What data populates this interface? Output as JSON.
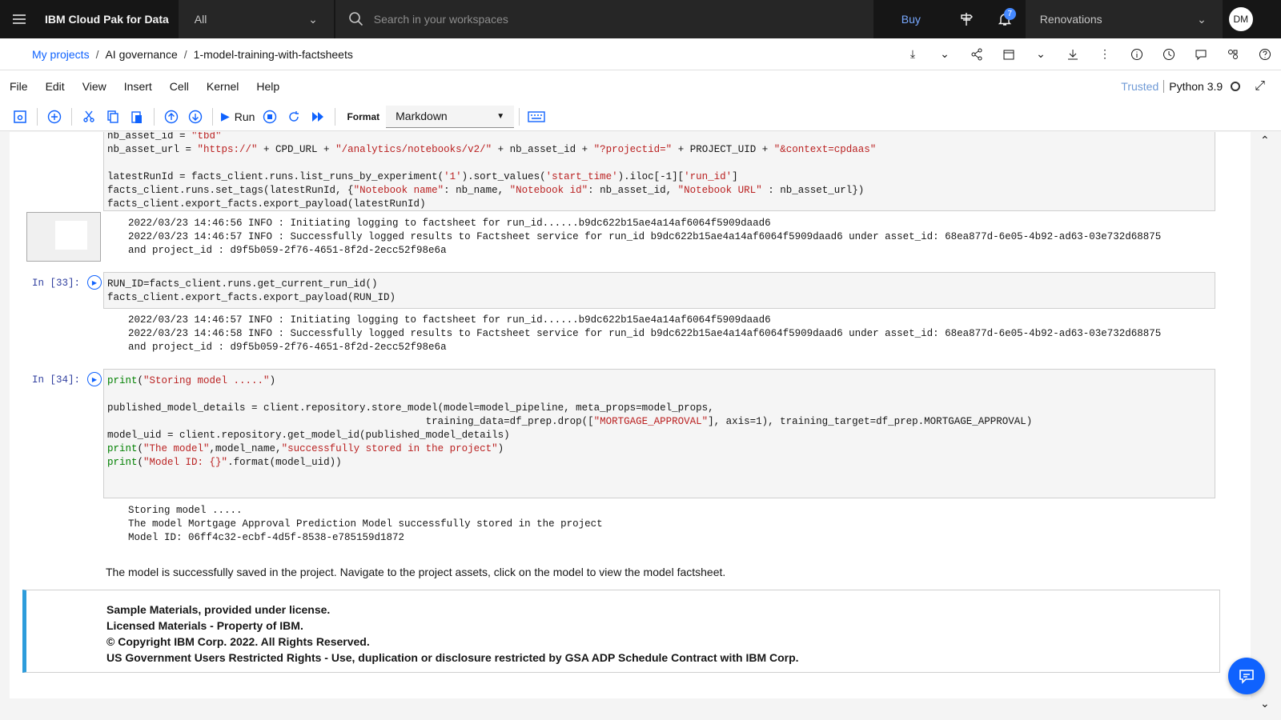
{
  "topbar": {
    "brand": "IBM Cloud Pak for Data",
    "scope": "All",
    "search_placeholder": "Search in your workspaces",
    "buy": "Buy",
    "notif_count": "7",
    "account": "Renovations",
    "avatar": "DM"
  },
  "breadcrumb": {
    "items": [
      "My projects",
      "AI governance",
      "1-model-training-with-factsheets"
    ]
  },
  "menu": {
    "items": [
      "File",
      "Edit",
      "View",
      "Insert",
      "Cell",
      "Kernel",
      "Help"
    ],
    "trusted": "Trusted",
    "kernel": "Python 3.9"
  },
  "toolbar": {
    "run": "Run",
    "format_label": "Format",
    "format_value": "Markdown"
  },
  "cells": {
    "c1_lines": [
      "nb_asset_id = \"tbd\"",
      "nb_asset_url = \"https://\" + CPD_URL + \"/analytics/notebooks/v2/\" + nb_asset_id + \"?projectid=\" + PROJECT_UID + \"&context=cpdaas\"",
      "",
      "latestRunId = facts_client.runs.list_runs_by_experiment('1').sort_values('start_time').iloc[-1]['run_id']",
      "facts_client.runs.set_tags(latestRunId, {\"Notebook name\": nb_name, \"Notebook id\": nb_asset_id, \"Notebook URL\" : nb_asset_url})",
      "facts_client.export_facts.export_payload(latestRunId)"
    ],
    "o1_lines": [
      "2022/03/23 14:46:56 INFO : Initiating logging to factsheet for run_id......b9dc622b15ae4a14af6064f5909daad6",
      "2022/03/23 14:46:57 INFO : Successfully logged results to Factsheet service for run_id b9dc622b15ae4a14af6064f5909daad6 under asset_id: 68ea877d-6e05-4b92-ad63-03e732d68875",
      "and project_id : d9f5b059-2f76-4651-8f2d-2ecc52f98e6a"
    ],
    "c2_prompt": "In [33]:",
    "c2_lines": [
      "RUN_ID=facts_client.runs.get_current_run_id()",
      "facts_client.export_facts.export_payload(RUN_ID)"
    ],
    "o2_lines": [
      "2022/03/23 14:46:57 INFO : Initiating logging to factsheet for run_id......b9dc622b15ae4a14af6064f5909daad6",
      "2022/03/23 14:46:58 INFO : Successfully logged results to Factsheet service for run_id b9dc622b15ae4a14af6064f5909daad6 under asset_id: 68ea877d-6e05-4b92-ad63-03e732d68875",
      "and project_id : d9f5b059-2f76-4651-8f2d-2ecc52f98e6a"
    ],
    "c3_prompt": "In [34]:",
    "c3_lines": [
      "print(\"Storing model .....\")",
      "",
      "published_model_details = client.repository.store_model(model=model_pipeline, meta_props=model_props,",
      "                                                     training_data=df_prep.drop([\"MORTGAGE_APPROVAL\"], axis=1), training_target=df_prep.MORTGAGE_APPROVAL)",
      "model_uid = client.repository.get_model_id(published_model_details)",
      "print(\"The model\",model_name,\"successfully stored in the project\")",
      "print(\"Model ID: {}\".format(model_uid))"
    ],
    "o3_lines": [
      "Storing model .....",
      "The model Mortgage Approval Prediction Model successfully stored in the project",
      "Model ID: 06ff4c32-ecbf-4d5f-8538-e785159d1872"
    ],
    "markdown": "The model is successfully saved in the project. Navigate to the project assets, click on the model to view the model factsheet.",
    "notice": [
      "Sample Materials, provided under license.",
      "Licensed Materials - Property of IBM.",
      "© Copyright IBM Corp. 2022. All Rights Reserved.",
      "US Government Users Restricted Rights - Use, duplication or disclosure restricted by GSA ADP Schedule Contract with IBM Corp."
    ]
  }
}
